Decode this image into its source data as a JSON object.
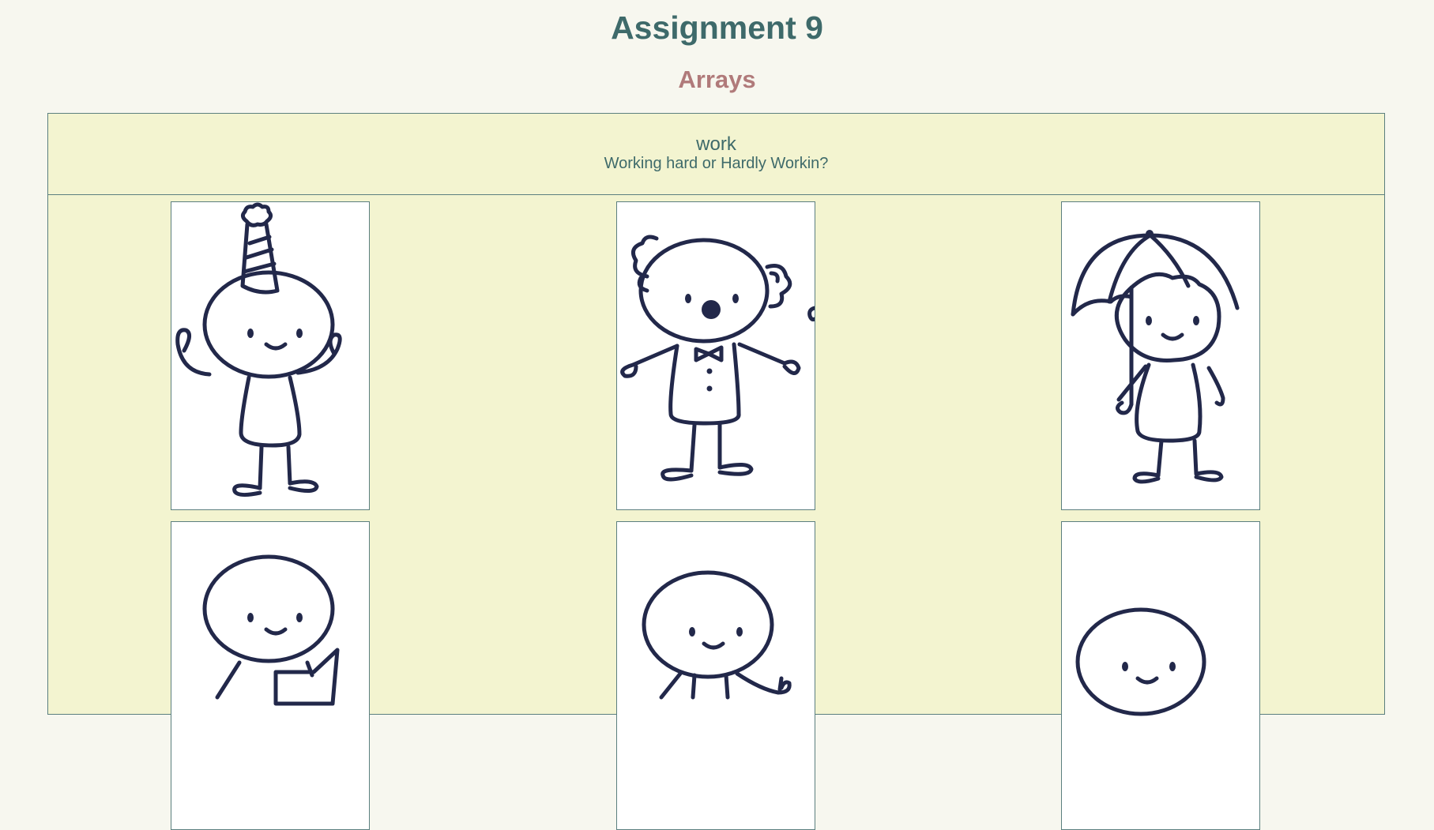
{
  "header": {
    "title": "Assignment 9",
    "subtitle": "Arrays"
  },
  "panel": {
    "title": "work",
    "tagline": "Working hard or Hardly Workin?"
  },
  "cards": [
    {
      "icon": "party-hat-stick-figure-icon"
    },
    {
      "icon": "clown-stick-figure-icon"
    },
    {
      "icon": "umbrella-stick-figure-icon"
    },
    {
      "icon": "book-reading-stick-figure-icon"
    },
    {
      "icon": "waving-stick-figure-icon"
    },
    {
      "icon": "stick-figure-icon"
    }
  ],
  "colors": {
    "background": "#f7f7ef",
    "panel": "#f3f4d0",
    "title": "#3e6a6a",
    "subtitle": "#b07a7a",
    "ink": "#22284a"
  }
}
